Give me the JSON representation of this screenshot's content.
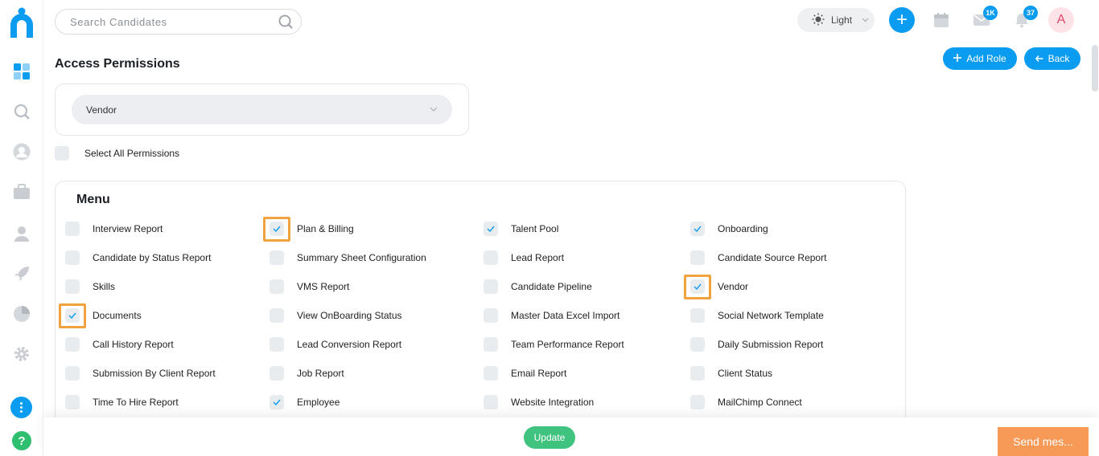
{
  "search": {
    "placeholder": "Search Candidates"
  },
  "header": {
    "theme_label": "Light",
    "mail_badge": "1K",
    "notification_badge": "37",
    "avatar_initial": "A"
  },
  "page": {
    "title": "Access Permissions",
    "add_role_label": "Add Role",
    "back_label": "Back"
  },
  "role_select": {
    "value": "Vendor"
  },
  "select_all_label": "Select All Permissions",
  "menu": {
    "title": "Menu",
    "columns": [
      [
        {
          "label": "Interview Report",
          "checked": false,
          "highlighted": false
        },
        {
          "label": "Candidate by Status Report",
          "checked": false,
          "highlighted": false
        },
        {
          "label": "Skills",
          "checked": false,
          "highlighted": false
        },
        {
          "label": "Documents",
          "checked": true,
          "highlighted": true
        },
        {
          "label": "Call History Report",
          "checked": false,
          "highlighted": false
        },
        {
          "label": "Submission By Client Report",
          "checked": false,
          "highlighted": false
        },
        {
          "label": "Time To Hire Report",
          "checked": false,
          "highlighted": false
        }
      ],
      [
        {
          "label": "Plan & Billing",
          "checked": true,
          "highlighted": true
        },
        {
          "label": "Summary Sheet Configuration",
          "checked": false,
          "highlighted": false
        },
        {
          "label": "VMS Report",
          "checked": false,
          "highlighted": false
        },
        {
          "label": "View OnBoarding Status",
          "checked": false,
          "highlighted": false
        },
        {
          "label": "Lead Conversion Report",
          "checked": false,
          "highlighted": false
        },
        {
          "label": "Job Report",
          "checked": false,
          "highlighted": false
        },
        {
          "label": "Employee",
          "checked": true,
          "highlighted": false
        }
      ],
      [
        {
          "label": "Talent Pool",
          "checked": true,
          "highlighted": false
        },
        {
          "label": "Lead Report",
          "checked": false,
          "highlighted": false
        },
        {
          "label": "Candidate Pipeline",
          "checked": false,
          "highlighted": false
        },
        {
          "label": "Master Data Excel Import",
          "checked": false,
          "highlighted": false
        },
        {
          "label": "Team Performance Report",
          "checked": false,
          "highlighted": false
        },
        {
          "label": "Email Report",
          "checked": false,
          "highlighted": false
        },
        {
          "label": "Website Integration",
          "checked": false,
          "highlighted": false
        }
      ],
      [
        {
          "label": "Onboarding",
          "checked": true,
          "highlighted": false
        },
        {
          "label": "Candidate Source Report",
          "checked": false,
          "highlighted": false
        },
        {
          "label": "Vendor",
          "checked": true,
          "highlighted": true
        },
        {
          "label": "Social Network Template",
          "checked": false,
          "highlighted": false
        },
        {
          "label": "Daily Submission Report",
          "checked": false,
          "highlighted": false
        },
        {
          "label": "Client Status",
          "checked": false,
          "highlighted": false
        },
        {
          "label": "MailChimp Connect",
          "checked": false,
          "highlighted": false
        }
      ]
    ]
  },
  "footer": {
    "update_label": "Update",
    "send_message_label": "Send mes..."
  },
  "colors": {
    "accent": "#0a9cf0",
    "success": "#41c380",
    "highlight": "#f0a23e",
    "chat": "#f79a57"
  },
  "icons": {
    "sidebar": [
      "dashboard-icon",
      "search-icon",
      "user-icon",
      "briefcase-icon",
      "recruiter-icon",
      "rocket-icon",
      "pie-chart-icon",
      "settings-icon"
    ],
    "header": [
      "sun-icon",
      "plus-icon",
      "calendar-icon",
      "mail-icon",
      "bell-icon"
    ]
  }
}
